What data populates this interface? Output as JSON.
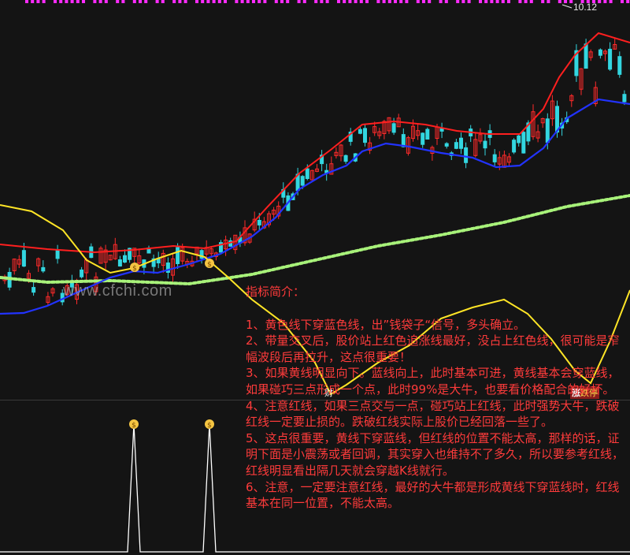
{
  "chart": {
    "price_label": "10.12",
    "watermark": "www.cfchi.com",
    "marker_left": "财",
    "marker_right_prefix": "涨",
    "marker_right_suffix": "跌停",
    "colors": {
      "background": "#141414",
      "up": "#ff2a2a",
      "down": "#33d6e0",
      "ma_red": "#ff1f1f",
      "ma_blue": "#2233ff",
      "ma_yellow": "#ffe526",
      "ma_green_dots": "#a8f27a",
      "marker_magenta": "#ff2bff"
    }
  },
  "description": {
    "title": "指标简介：",
    "items": [
      "1、黄色线下穿蓝色线，出”钱袋子“信号，多头确立。",
      "2、带量交叉后，股价站上红色追涨线最好，没占上红色线，很可能是窄幅波段后再拉升，这点很重要！",
      "3、如果黄线明显向下。蓝线向上，此时基本可进，黄线基本会穿蓝线，如果碰巧三点形成一个点，此时99%是大牛，也要看价格配合的好坏。",
      "4、注意红线，如果三点交与一点，碰巧站上红线，此时强势大牛，跌破红线一定要止损的。跌破红线实际上股价已经回落一些了。",
      "5、这点很重要，黄线下穿蓝线，但红线的位置不能太高，那样的话，证明下面是小震荡或者回调，其实穿入也维持不了多久，所以要参考红线，红线明显看出隔几天就会穿越K线就行。",
      "6、注意，一定要注意红线，最好的大牛都是形成黄线下穿蓝线时，红线基本在同一位置，不能太高。"
    ]
  }
}
